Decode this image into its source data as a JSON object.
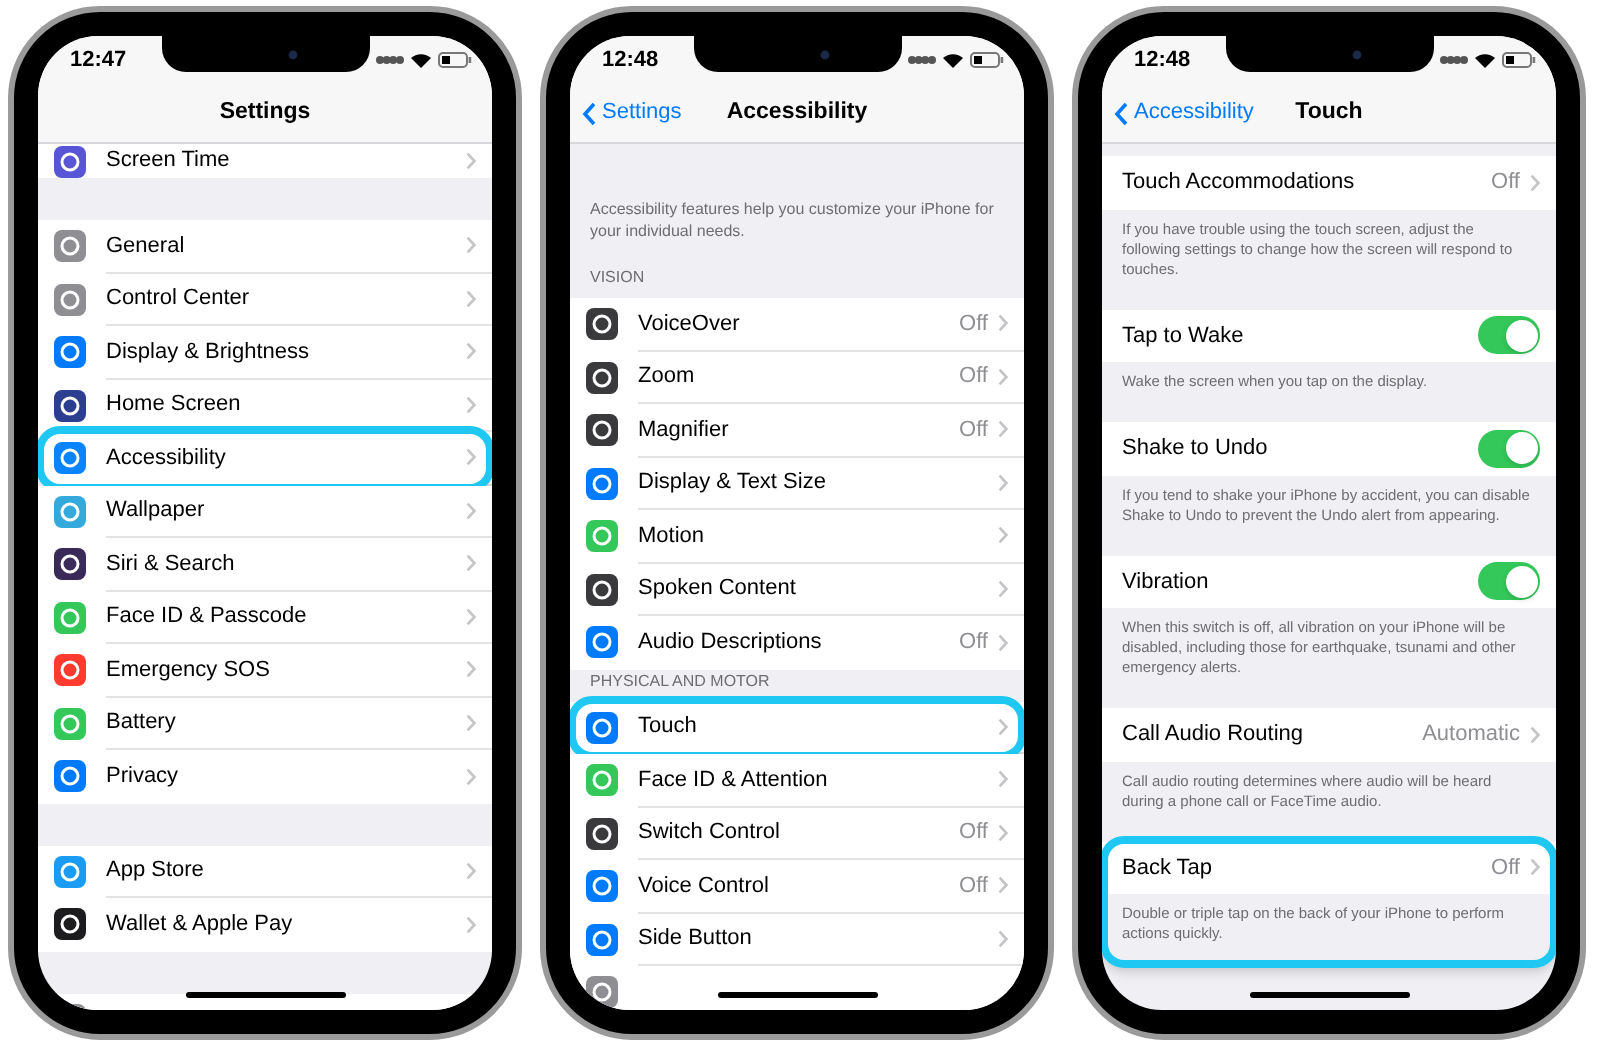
{
  "phones": [
    {
      "time": "12:47",
      "nav": {
        "title": "Settings"
      },
      "sections": [
        {
          "kind": "group",
          "rows": [
            {
              "label": "Screen Time",
              "kind": "link",
              "color": "#5856d6",
              "highlighted": false
            }
          ]
        },
        {
          "kind": "group",
          "rows": [
            {
              "label": "General",
              "kind": "link",
              "color": "#8e8e93",
              "highlighted": false
            },
            {
              "label": "Control Center",
              "kind": "link",
              "color": "#8e8e93",
              "highlighted": false
            },
            {
              "label": "Display & Brightness",
              "kind": "link",
              "color": "#007aff",
              "highlighted": false
            },
            {
              "label": "Home Screen",
              "kind": "link",
              "color": "#2c3e8f",
              "highlighted": false
            },
            {
              "label": "Accessibility",
              "kind": "link",
              "color": "#0a84ff",
              "highlighted": true
            },
            {
              "label": "Wallpaper",
              "kind": "link",
              "color": "#34aadc",
              "highlighted": false
            },
            {
              "label": "Siri & Search",
              "kind": "link",
              "color": "#3a2a5a",
              "highlighted": false
            },
            {
              "label": "Face ID & Passcode",
              "kind": "link",
              "color": "#34c759",
              "highlighted": false
            },
            {
              "label": "Emergency SOS",
              "kind": "link",
              "color": "#ff3b30",
              "highlighted": false
            },
            {
              "label": "Battery",
              "kind": "link",
              "color": "#34c759",
              "highlighted": false
            },
            {
              "label": "Privacy",
              "kind": "link",
              "color": "#007aff",
              "highlighted": false
            }
          ]
        },
        {
          "kind": "group",
          "rows": [
            {
              "label": "App Store",
              "kind": "link",
              "color": "#1a9cf5",
              "highlighted": false
            },
            {
              "label": "Wallet & Apple Pay",
              "kind": "link",
              "color": "#1c1c1e",
              "highlighted": false
            }
          ]
        },
        {
          "kind": "group",
          "rows": [
            {
              "kind": "partial",
              "color": "#8e8e93"
            }
          ]
        }
      ]
    },
    {
      "time": "12:48",
      "nav": {
        "back": "Settings",
        "title": "Accessibility"
      },
      "sections": [
        {
          "kind": "note",
          "text": "Accessibility features help you customize your iPhone for your individual needs."
        },
        {
          "kind": "group",
          "header": "VISION",
          "rows": [
            {
              "label": "VoiceOver",
              "value": "Off",
              "kind": "link",
              "color": "#3a3a3c",
              "highlighted": false
            },
            {
              "label": "Zoom",
              "value": "Off",
              "kind": "link",
              "color": "#3a3a3c",
              "highlighted": false
            },
            {
              "label": "Magnifier",
              "value": "Off",
              "kind": "link",
              "color": "#3a3a3c",
              "highlighted": false
            },
            {
              "label": "Display & Text Size",
              "kind": "link",
              "color": "#007aff",
              "highlighted": false
            },
            {
              "label": "Motion",
              "kind": "link",
              "color": "#34c759",
              "highlighted": false
            },
            {
              "label": "Spoken Content",
              "kind": "link",
              "color": "#3a3a3c",
              "highlighted": false
            },
            {
              "label": "Audio Descriptions",
              "value": "Off",
              "kind": "link",
              "color": "#007aff",
              "highlighted": false
            }
          ]
        },
        {
          "kind": "group",
          "header": "PHYSICAL AND MOTOR",
          "rows": [
            {
              "label": "Touch",
              "kind": "link",
              "color": "#007aff",
              "highlighted": true
            },
            {
              "label": "Face ID & Attention",
              "kind": "link",
              "color": "#34c759",
              "highlighted": false
            },
            {
              "label": "Switch Control",
              "value": "Off",
              "kind": "link",
              "color": "#3a3a3c",
              "highlighted": false
            },
            {
              "label": "Voice Control",
              "value": "Off",
              "kind": "link",
              "color": "#007aff",
              "highlighted": false
            },
            {
              "label": "Side Button",
              "kind": "link",
              "color": "#007aff",
              "highlighted": false
            },
            {
              "kind": "partial",
              "color": "#8e8e93"
            }
          ]
        }
      ]
    },
    {
      "time": "12:48",
      "nav": {
        "back": "Accessibility",
        "title": "Touch"
      },
      "sections": [
        {
          "kind": "group",
          "rows": [
            {
              "label": "Touch Accommodations",
              "value": "Off",
              "kind": "link",
              "highlighted": false,
              "footer": "If you have trouble using the touch screen, adjust the following settings to change how the screen will respond to touches."
            }
          ]
        },
        {
          "kind": "group",
          "rows": [
            {
              "label": "Tap to Wake",
              "kind": "toggle",
              "on": true,
              "highlighted": false,
              "footer": "Wake the screen when you tap on the display."
            }
          ]
        },
        {
          "kind": "group",
          "rows": [
            {
              "label": "Shake to Undo",
              "kind": "toggle",
              "on": true,
              "highlighted": false,
              "footer": "If you tend to shake your iPhone by accident, you can disable Shake to Undo to prevent the Undo alert from appearing."
            }
          ]
        },
        {
          "kind": "group",
          "rows": [
            {
              "label": "Vibration",
              "kind": "toggle",
              "on": true,
              "highlighted": false,
              "footer": "When this switch is off, all vibration on your iPhone will be disabled, including those for earthquake, tsunami and other emergency alerts."
            }
          ]
        },
        {
          "kind": "group",
          "rows": [
            {
              "label": "Call Audio Routing",
              "value": "Automatic",
              "kind": "link",
              "highlighted": false,
              "footer": "Call audio routing determines where audio will be heard during a phone call or FaceTime audio."
            }
          ]
        },
        {
          "kind": "group",
          "rows": [
            {
              "label": "Back Tap",
              "value": "Off",
              "kind": "link",
              "highlighted": true,
              "footer": "Double or triple tap on the back of your iPhone to perform actions quickly."
            }
          ]
        }
      ]
    }
  ]
}
